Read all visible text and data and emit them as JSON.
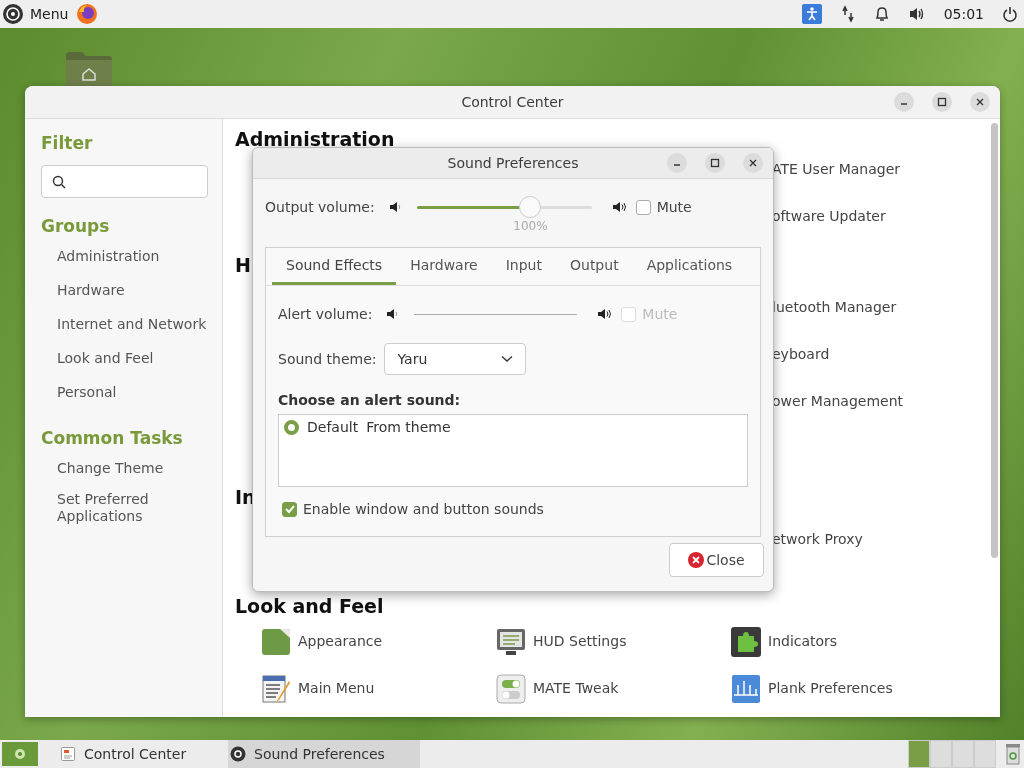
{
  "top_panel": {
    "menu_label": "Menu",
    "clock": "05:01"
  },
  "control_center": {
    "title": "Control Center",
    "filter_title": "Filter",
    "groups_title": "Groups",
    "groups": [
      {
        "label": "Administration"
      },
      {
        "label": "Hardware"
      },
      {
        "label": "Internet and Network"
      },
      {
        "label": "Look and Feel"
      },
      {
        "label": "Personal"
      }
    ],
    "tasks_title": "Common Tasks",
    "tasks": [
      {
        "label": "Change Theme"
      },
      {
        "label": "Set Preferred Applications"
      }
    ],
    "sections": [
      {
        "heading": "Administration",
        "items": [
          {
            "kind": "covered",
            "label": "ATE User Manager"
          },
          {
            "kind": "covered",
            "label": "oftware Updater"
          }
        ]
      },
      {
        "heading": "H",
        "items": [
          {
            "kind": "covered",
            "label": "luetooth Manager"
          },
          {
            "kind": "covered",
            "label": "eyboard"
          },
          {
            "kind": "covered",
            "label": "ower Management"
          }
        ]
      },
      {
        "heading": "In",
        "items": [
          {
            "kind": "covered",
            "label": "etwork Proxy"
          }
        ]
      },
      {
        "heading": "Look and Feel",
        "items": [
          {
            "kind": "launcher",
            "label": "Appearance"
          },
          {
            "kind": "launcher",
            "label": "HUD Settings"
          },
          {
            "kind": "launcher",
            "label": "Indicators"
          },
          {
            "kind": "launcher",
            "label": "Main Menu"
          },
          {
            "kind": "launcher",
            "label": "MATE Tweak"
          },
          {
            "kind": "launcher",
            "label": "Plank Preferences"
          }
        ]
      }
    ]
  },
  "sound_dialog": {
    "title": "Sound Preferences",
    "output": {
      "label": "Output volume:",
      "level": 0.65,
      "reading": "100%",
      "mute": {
        "label": "Mute",
        "checked": false
      }
    },
    "tabs": [
      {
        "label": "Sound Effects",
        "selected": true
      },
      {
        "label": "Hardware",
        "selected": false
      },
      {
        "label": "Input",
        "selected": false
      },
      {
        "label": "Output",
        "selected": false
      },
      {
        "label": "Applications",
        "selected": false
      }
    ],
    "alert": {
      "label": "Alert volume:",
      "disabled": true,
      "mute": {
        "label": "Mute",
        "checked": false
      }
    },
    "theme": {
      "label": "Sound theme:",
      "value": "Yaru"
    },
    "alert_sounds_title": "Choose an alert sound:",
    "alert_sounds": [
      {
        "name": "Default",
        "source": "From theme",
        "selected": true
      }
    ],
    "window_sounds": {
      "label": "Enable window and button sounds",
      "checked": true
    },
    "close_label": "Close"
  },
  "taskbar": {
    "items": [
      {
        "label": "Control Center",
        "selected": false
      },
      {
        "label": "Sound Preferences",
        "selected": true
      }
    ],
    "workspaces": [
      {
        "selected": true
      },
      {
        "selected": false
      },
      {
        "selected": false
      },
      {
        "selected": false
      }
    ]
  }
}
